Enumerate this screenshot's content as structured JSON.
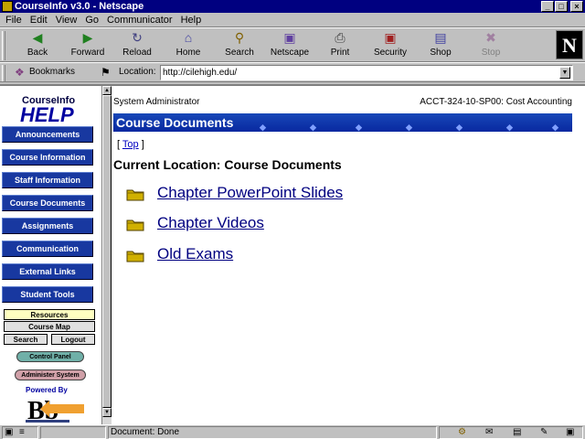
{
  "window": {
    "title": "CourseInfo v3.0 - Netscape",
    "min": "_",
    "max": "□",
    "close": "×"
  },
  "menu": [
    "File",
    "Edit",
    "View",
    "Go",
    "Communicator",
    "Help"
  ],
  "toolbar": {
    "back": "Back",
    "forward": "Forward",
    "reload": "Reload",
    "home": "Home",
    "search": "Search",
    "netscape": "Netscape",
    "print": "Print",
    "security": "Security",
    "shop": "Shop",
    "stop": "Stop",
    "logo": "N"
  },
  "location": {
    "bookmarks_label": "Bookmarks",
    "location_label": "Location:",
    "url": "http://cilehigh.edu/"
  },
  "sidebar": {
    "logo_top": "CourseInfo",
    "logo_bottom": "HELP",
    "nav": [
      "Announcements",
      "Course Information",
      "Staff Information",
      "Course Documents",
      "Assignments",
      "Communication",
      "External Links",
      "Student Tools"
    ],
    "resources": "Resources",
    "course_map": "Course Map",
    "search": "Search",
    "logout": "Logout",
    "control_panel": "Control Panel",
    "administer": "Administer System",
    "powered_by": "Powered By",
    "bb_logo": "Bb"
  },
  "main": {
    "user": "System Administrator",
    "course": "ACCT-324-10-SP00: Cost Accounting",
    "header": "Course Documents",
    "top_bracket_open": "[",
    "top_link": "Top",
    "top_bracket_close": "]",
    "current_location": "Current Location: Course Documents",
    "folders": [
      "Chapter PowerPoint Slides",
      "Chapter Videos",
      "Old Exams"
    ]
  },
  "status": {
    "text": "Document: Done"
  },
  "colors": {
    "title_bar": "#000080",
    "nav_button": "#1838a0",
    "header_bar": "#1848b8",
    "link": "#000080",
    "folder": "#d0b000"
  }
}
